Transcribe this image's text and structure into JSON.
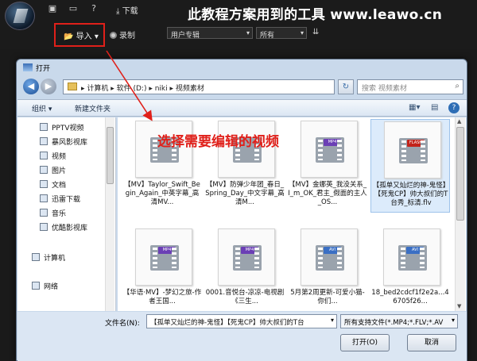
{
  "app": {
    "download_label": "下载",
    "banner": "此教程方案用到的工具    www.leawo.cn",
    "import_label": "导入",
    "record_label": "录制",
    "album_select": "用户专辑",
    "filter_select": "所有"
  },
  "dialog": {
    "title": "打开",
    "address": "▸ 计算机 ▸ 软件 (D:) ▸ niki ▸ 视频素材",
    "search_placeholder": "搜索 视频素材",
    "organize_label": "组织 ▾",
    "new_folder_label": "新建文件夹",
    "nav_items": [
      {
        "label": "PPTV视频"
      },
      {
        "label": "暴风影视库"
      },
      {
        "label": "视频"
      },
      {
        "label": "图片"
      },
      {
        "label": "文档"
      },
      {
        "label": "迅雷下载"
      },
      {
        "label": "音乐"
      },
      {
        "label": "优酷影视库"
      },
      {
        "label": "计算机"
      },
      {
        "label": "网络"
      }
    ],
    "files": [
      {
        "name": "【MV】Taylor_Swift_Begin_Again_中英字幕_高清MV...",
        "tag": ""
      },
      {
        "name": "【MV】防弹少年团_春日_Spring_Day_中文字幕_高清M...",
        "tag": ""
      },
      {
        "name": "【MV】金娜英_我没关系_I_m_OK_君主_假面的主人_OS...",
        "tag": "MP4"
      },
      {
        "name": "【孤单又灿烂的神-鬼怪】【死鬼CP】帅大叔们的T台秀_标清.flv",
        "tag": "FLASH"
      },
      {
        "name": "【华语·MV】-梦幻之旅-作者王国...",
        "tag": "MP4"
      },
      {
        "name": "0001.音悦台-凉凉-电视剧《三生...",
        "tag": "MP4"
      },
      {
        "name": "5月第2周更新-可爱小猫-你们...",
        "tag": "AVI"
      },
      {
        "name": "18_bed2cdcf1f2e2a...46705f26...",
        "tag": "AVI"
      }
    ],
    "filename_label": "文件名(N):",
    "filename_value": "【孤单又灿烂的神-鬼怪】【死鬼CP】帅大叔们的T台",
    "filetype_value": "所有支持文件(*.MP4;*.FLV;*.AV",
    "open_label": "打开(O)",
    "cancel_label": "取消"
  },
  "annotation": {
    "text": "选择需要编辑的视频",
    "color": "#e0201a"
  }
}
